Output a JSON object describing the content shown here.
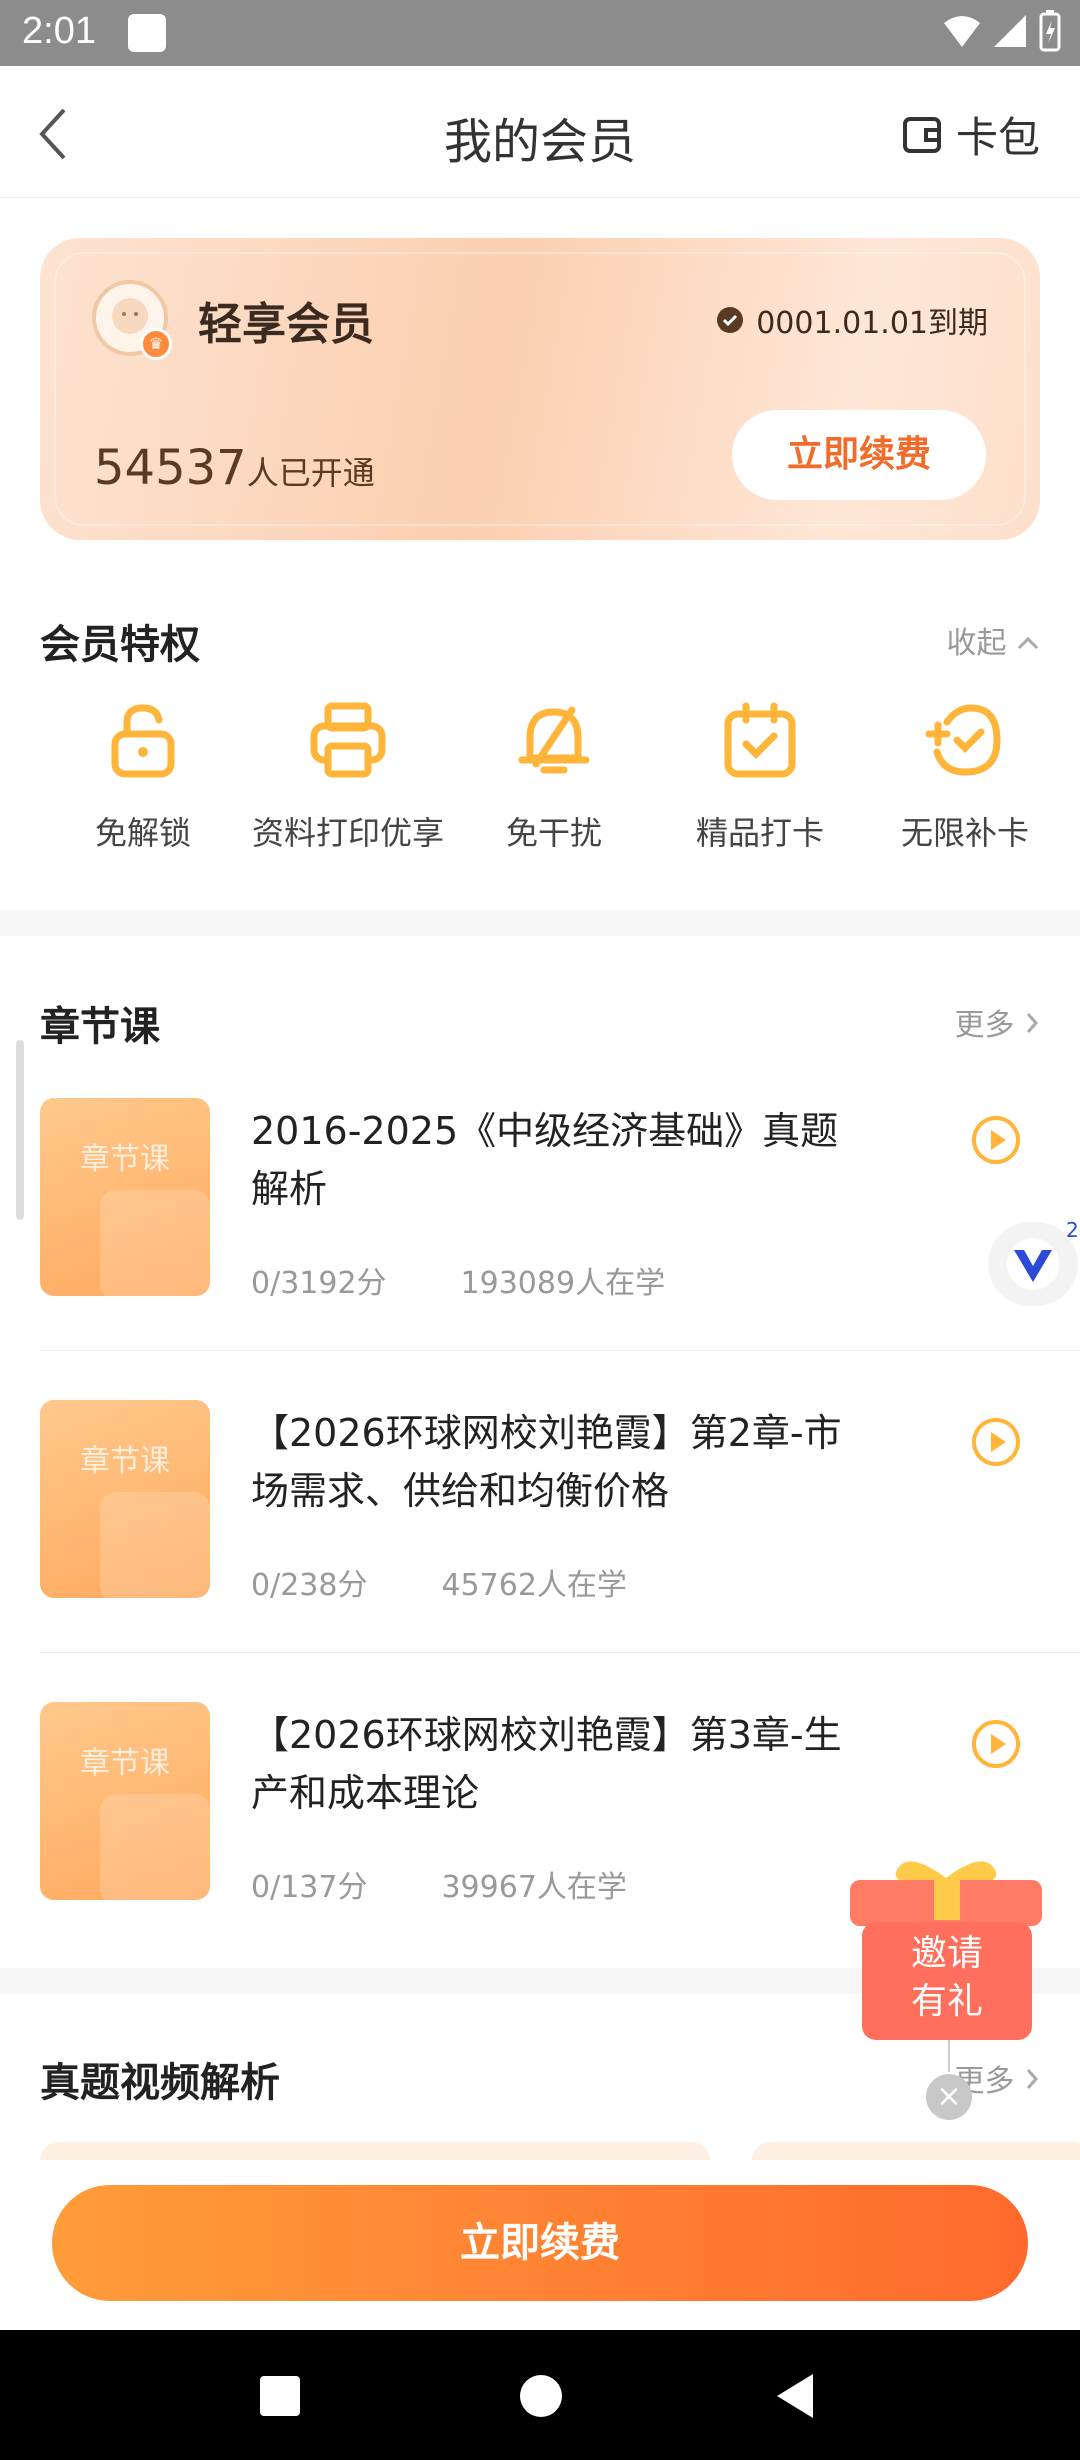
{
  "status_bar": {
    "time": "2:01"
  },
  "header": {
    "title": "我的会员",
    "wallet_label": "卡包"
  },
  "member_card": {
    "name": "轻享会员",
    "expire_text": "0001.01.01到期",
    "member_count": "54537",
    "member_count_suffix": "人已开通",
    "renew_label": "立即续费"
  },
  "privileges": {
    "title": "会员特权",
    "collapse_label": "收起",
    "items": [
      {
        "label": "免解锁",
        "icon": "unlock-icon"
      },
      {
        "label": "资料打印优享",
        "icon": "printer-icon"
      },
      {
        "label": "免干扰",
        "icon": "no-disturb-icon"
      },
      {
        "label": "精品打卡",
        "icon": "calendar-check-icon"
      },
      {
        "label": "无限补卡",
        "icon": "plus-check-icon"
      }
    ]
  },
  "chapter_courses": {
    "title": "章节课",
    "more_label": "更多",
    "thumb_label": "章节课",
    "items": [
      {
        "title": "2016-2025《中级经济基础》真题解析",
        "score": "0/3192分",
        "learners": "193089人在学"
      },
      {
        "title": "【2026环球网校刘艳霞】第2章-市场需求、供给和均衡价格",
        "score": "0/238分",
        "learners": "45762人在学"
      },
      {
        "title": "【2026环球网校刘艳霞】第3章-生产和成本理论",
        "score": "0/137分",
        "learners": "39967人在学"
      }
    ]
  },
  "video_analysis": {
    "title": "真题视频解析",
    "more_label": "更多"
  },
  "floating": {
    "badge_count": "2",
    "gift_text_1": "邀请",
    "gift_text_2": "有礼"
  },
  "bottom": {
    "renew_label": "立即续费"
  },
  "colors": {
    "accent": "#ff7a30",
    "card_bg": "#fcd4b8",
    "icon_orange": "#ffb43a"
  }
}
